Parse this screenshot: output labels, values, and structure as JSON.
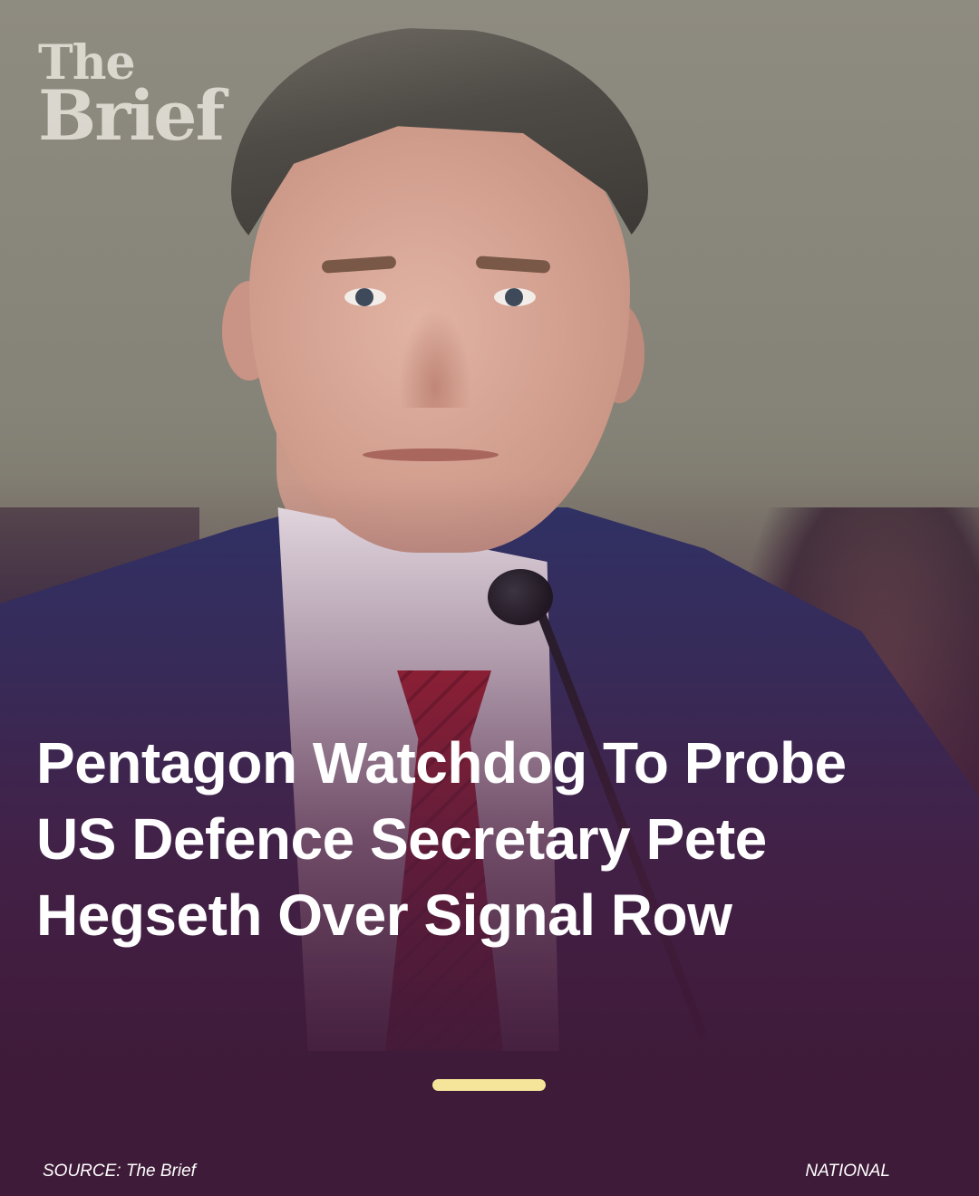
{
  "brand": {
    "logo_line1": "The",
    "logo_line2": "Brief"
  },
  "article": {
    "headline": "Pentagon Watchdog To Probe US Defence Secretary Pete Hegseth Over Signal Row",
    "image_subject": "man in suit speaking at microphone"
  },
  "pager": {
    "active_color": "#f5e59a"
  },
  "footer": {
    "source": "SOURCE: The Brief",
    "category": "NATIONAL"
  },
  "colors": {
    "background": "#3e1b38",
    "text": "#ffffff",
    "accent": "#f5e59a"
  }
}
